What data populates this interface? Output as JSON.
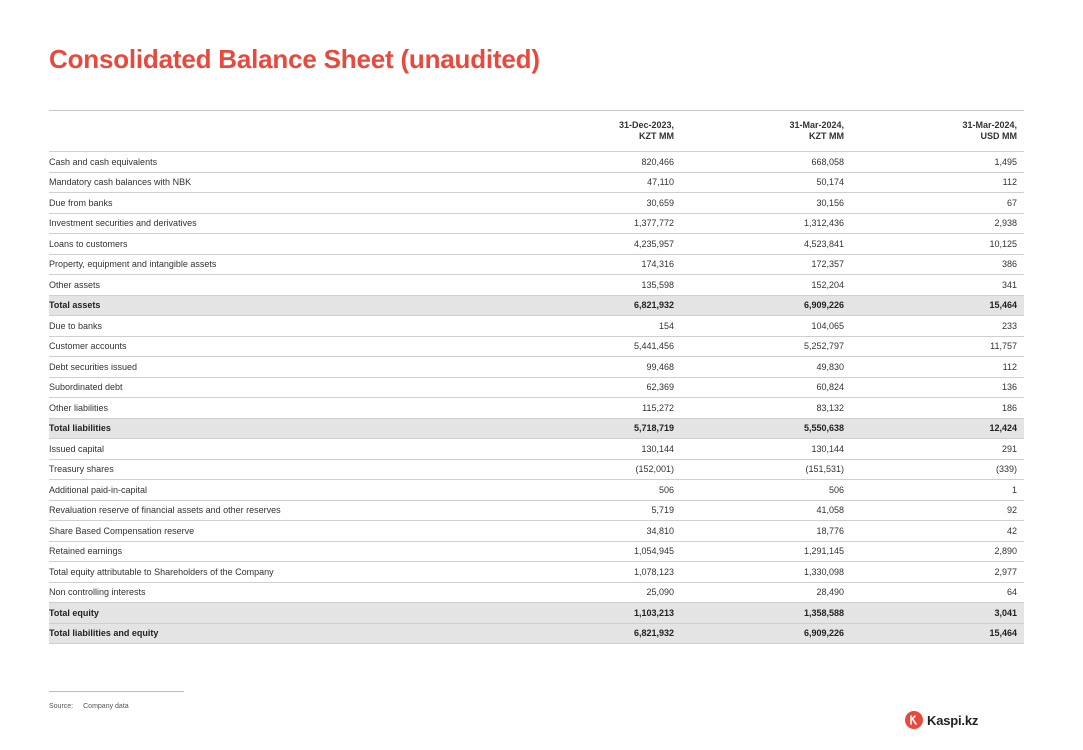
{
  "page": {
    "title": "Consolidated Balance Sheet (unaudited)"
  },
  "table": {
    "columns": [
      {
        "line1": "31-Dec-2023,",
        "line2": "KZT MM"
      },
      {
        "line1": "31-Mar-2024,",
        "line2": "KZT MM"
      },
      {
        "line1": "31-Mar-2024,",
        "line2": "USD MM"
      }
    ],
    "rows": [
      {
        "label": "Cash and cash equivalents",
        "values": [
          "820,466",
          "668,058",
          "1,495"
        ],
        "total": false
      },
      {
        "label": "Mandatory cash balances with NBK",
        "values": [
          "47,110",
          "50,174",
          "112"
        ],
        "total": false
      },
      {
        "label": "Due from banks",
        "values": [
          "30,659",
          "30,156",
          "67"
        ],
        "total": false
      },
      {
        "label": "Investment securities and derivatives",
        "values": [
          "1,377,772",
          "1,312,436",
          "2,938"
        ],
        "total": false
      },
      {
        "label": "Loans to customers",
        "values": [
          "4,235,957",
          "4,523,841",
          "10,125"
        ],
        "total": false
      },
      {
        "label": "Property, equipment and intangible assets",
        "values": [
          "174,316",
          "172,357",
          "386"
        ],
        "total": false
      },
      {
        "label": "Other assets",
        "values": [
          "135,598",
          "152,204",
          "341"
        ],
        "total": false
      },
      {
        "label": "Total assets",
        "values": [
          "6,821,932",
          "6,909,226",
          "15,464"
        ],
        "total": true
      },
      {
        "label": "Due to banks",
        "values": [
          "154",
          "104,065",
          "233"
        ],
        "total": false
      },
      {
        "label": "Customer accounts",
        "values": [
          "5,441,456",
          "5,252,797",
          "11,757"
        ],
        "total": false
      },
      {
        "label": "Debt securities issued",
        "values": [
          "99,468",
          "49,830",
          "112"
        ],
        "total": false
      },
      {
        "label": "Subordinated debt",
        "values": [
          "62,369",
          "60,824",
          "136"
        ],
        "total": false
      },
      {
        "label": "Other liabilities",
        "values": [
          "115,272",
          "83,132",
          "186"
        ],
        "total": false
      },
      {
        "label": "Total liabilities",
        "values": [
          "5,718,719",
          "5,550,638",
          "12,424"
        ],
        "total": true
      },
      {
        "label": "Issued capital",
        "values": [
          "130,144",
          "130,144",
          "291"
        ],
        "total": false
      },
      {
        "label": "Treasury shares",
        "values": [
          "(152,001)",
          "(151,531)",
          "(339)"
        ],
        "total": false
      },
      {
        "label": "Additional paid-in-capital",
        "values": [
          "506",
          "506",
          "1"
        ],
        "total": false
      },
      {
        "label": "Revaluation reserve of financial assets and other reserves",
        "values": [
          "5,719",
          "41,058",
          "92"
        ],
        "total": false
      },
      {
        "label": "Share Based Compensation reserve",
        "values": [
          "34,810",
          "18,776",
          "42"
        ],
        "total": false
      },
      {
        "label": "Retained earnings",
        "values": [
          "1,054,945",
          "1,291,145",
          "2,890"
        ],
        "total": false
      },
      {
        "label": "Total equity attributable to Shareholders of the Company",
        "values": [
          "1,078,123",
          "1,330,098",
          "2,977"
        ],
        "total": false
      },
      {
        "label": "Non controlling interests",
        "values": [
          "25,090",
          "28,490",
          "64"
        ],
        "total": false
      },
      {
        "label": "Total equity",
        "values": [
          "1,103,213",
          "1,358,588",
          "3,041"
        ],
        "total": true
      },
      {
        "label": "Total liabilities and equity",
        "values": [
          "6,821,932",
          "6,909,226",
          "15,464"
        ],
        "total": true
      }
    ]
  },
  "footer": {
    "source_label": "Source:",
    "source_value": "Company data",
    "logo_text": "Kaspi.kz"
  },
  "colors": {
    "accent": "#e8493c",
    "total_row_bg": "#e4e4e4"
  },
  "icons": {
    "logo": "kaspi-logo-icon"
  }
}
